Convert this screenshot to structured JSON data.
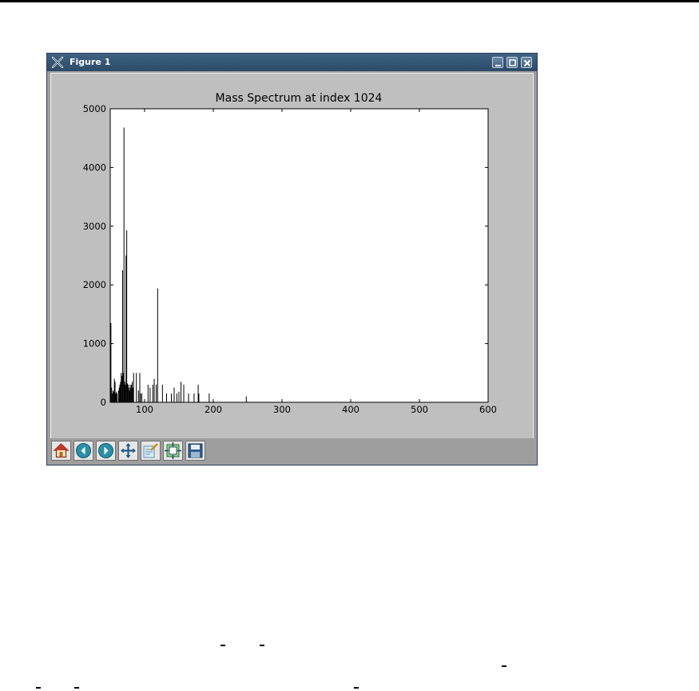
{
  "window": {
    "title": "Figure 1",
    "controls": [
      "minimize-icon",
      "maximize-icon",
      "close-icon"
    ]
  },
  "toolbar": {
    "tools": [
      "home-icon",
      "back-icon",
      "forward-icon",
      "pan-icon",
      "zoom-icon",
      "subplots-icon",
      "save-icon"
    ]
  },
  "chart_data": {
    "type": "bar",
    "title": "Mass Spectrum at index 1024",
    "xlabel": "",
    "ylabel": "",
    "xlim": [
      50,
      600
    ],
    "ylim": [
      0,
      5000
    ],
    "xticks": [
      100,
      200,
      300,
      400,
      500,
      600
    ],
    "yticks": [
      0,
      1000,
      2000,
      3000,
      4000,
      5000
    ],
    "xticklabels": [
      "100",
      "200",
      "300",
      "400",
      "500",
      "600"
    ],
    "yticklabels": [
      "0",
      "1000",
      "2000",
      "3000",
      "4000",
      "5000"
    ],
    "grid": false,
    "bar_color": "#000000",
    "x": [
      50,
      51,
      52,
      53,
      54,
      55,
      56,
      57,
      58,
      59,
      60,
      62,
      63,
      64,
      65,
      66,
      67,
      68,
      69,
      70,
      71,
      72,
      73,
      74,
      75,
      76,
      77,
      78,
      79,
      80,
      81,
      82,
      83,
      84,
      88,
      91,
      93,
      94,
      96,
      105,
      108,
      112,
      114,
      117,
      119,
      126,
      132,
      139,
      143,
      147,
      150,
      153,
      157,
      164,
      172,
      178,
      179,
      194,
      248
    ],
    "values": [
      800,
      1350,
      250,
      150,
      200,
      180,
      400,
      350,
      150,
      180,
      150,
      200,
      250,
      300,
      350,
      500,
      450,
      2250,
      500,
      4680,
      350,
      300,
      2500,
      2930,
      320,
      300,
      250,
      200,
      300,
      250,
      300,
      350,
      250,
      500,
      500,
      200,
      500,
      150,
      150,
      300,
      250,
      300,
      400,
      300,
      1940,
      300,
      150,
      150,
      250,
      150,
      180,
      350,
      300,
      150,
      150,
      300,
      150,
      150,
      100
    ]
  }
}
